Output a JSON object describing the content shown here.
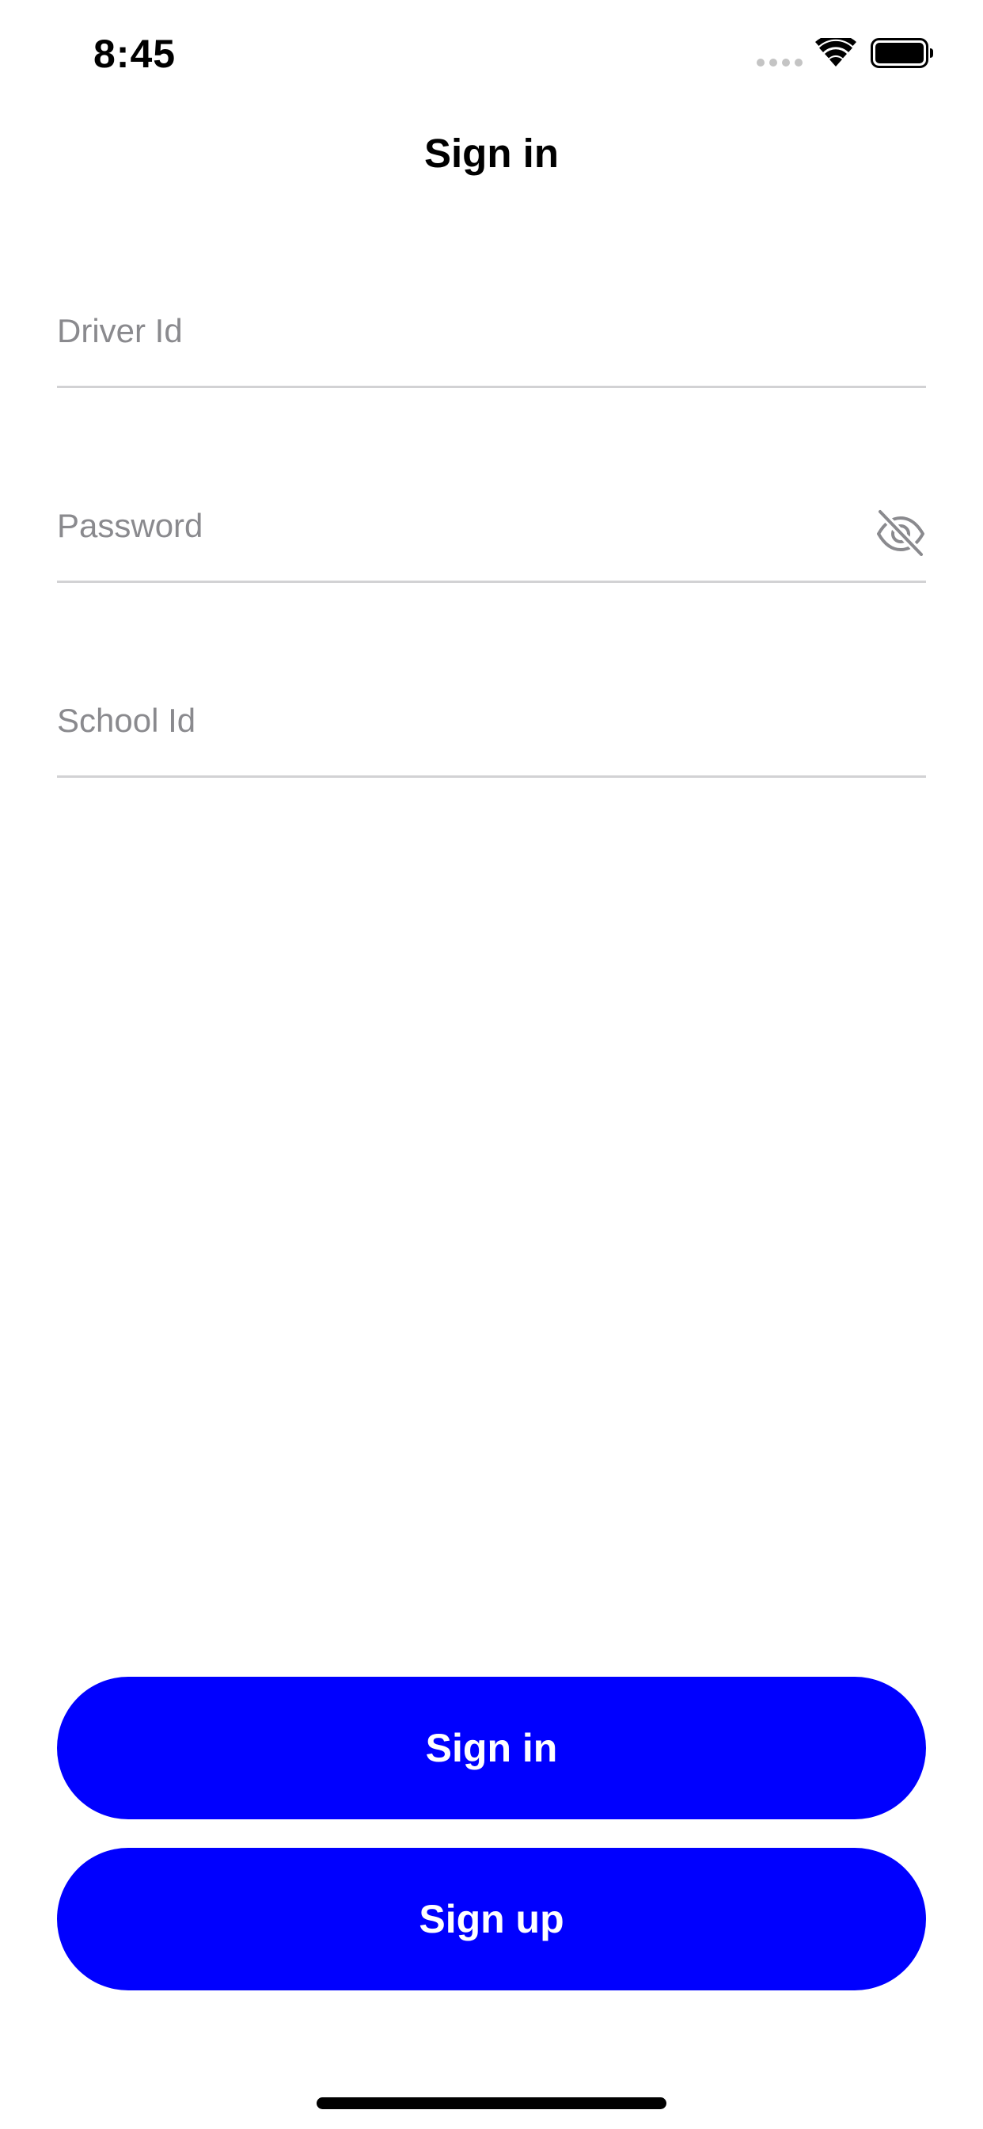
{
  "status_bar": {
    "time": "8:45",
    "wifi_icon": "wifi-icon",
    "battery_icon": "battery-icon"
  },
  "nav": {
    "title": "Sign in"
  },
  "form": {
    "driver_id": {
      "placeholder": "Driver Id",
      "value": ""
    },
    "password": {
      "placeholder": "Password",
      "value": "",
      "toggle_icon": "eye-slash-icon"
    },
    "school_id": {
      "placeholder": "School Id",
      "value": ""
    }
  },
  "actions": {
    "sign_in_label": "Sign in",
    "sign_up_label": "Sign up"
  },
  "colors": {
    "primary_button": "#0000ff",
    "button_text": "#ffffff",
    "placeholder": "#8a8a8e",
    "divider": "#d2d2d4"
  }
}
